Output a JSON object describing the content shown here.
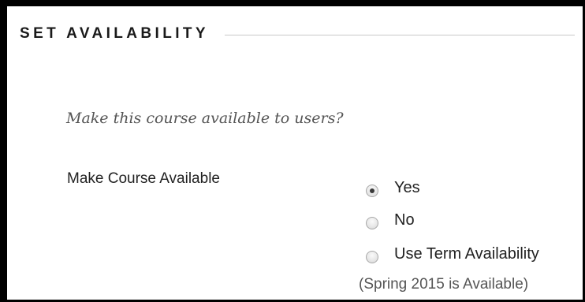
{
  "section": {
    "title": "SET AVAILABILITY"
  },
  "instructions": "Make this course available to users?",
  "availability": {
    "label": "Make Course Available",
    "options": [
      {
        "label": "Yes",
        "checked": true
      },
      {
        "label": "No",
        "checked": false
      },
      {
        "label": "Use Term Availability",
        "checked": false
      }
    ],
    "term_note": "(Spring 2015 is Available)"
  }
}
